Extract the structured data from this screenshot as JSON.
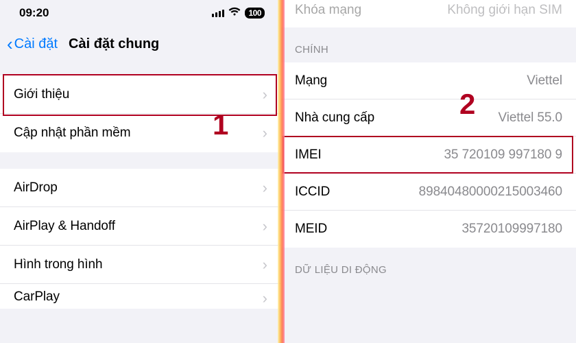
{
  "status": {
    "time": "09:20",
    "battery": "100"
  },
  "left": {
    "back": "Cài đặt",
    "title": "Cài đặt chung",
    "group1": [
      {
        "label": "Giới thiệu"
      },
      {
        "label": "Cập nhật phần mềm"
      }
    ],
    "group2": [
      {
        "label": "AirDrop"
      },
      {
        "label": "AirPlay & Handoff"
      },
      {
        "label": "Hình trong hình"
      },
      {
        "label": "CarPlay"
      }
    ]
  },
  "right": {
    "peek": {
      "label": "Khóa mạng",
      "value": "Không giới hạn SIM"
    },
    "section1_title": "CHÍNH",
    "rows": [
      {
        "label": "Mạng",
        "value": "Viettel"
      },
      {
        "label": "Nhà cung cấp",
        "value": "Viettel 55.0"
      },
      {
        "label": "IMEI",
        "value": "35 720109 997180 9"
      },
      {
        "label": "ICCID",
        "value": "89840480000215003460"
      },
      {
        "label": "MEID",
        "value": "35720109997180"
      }
    ],
    "section2_title": "DỮ LIỆU DI ĐỘNG"
  },
  "callouts": {
    "one": "1",
    "two": "2"
  },
  "colors": {
    "highlight": "#b00020",
    "ios_blue": "#007aff"
  }
}
